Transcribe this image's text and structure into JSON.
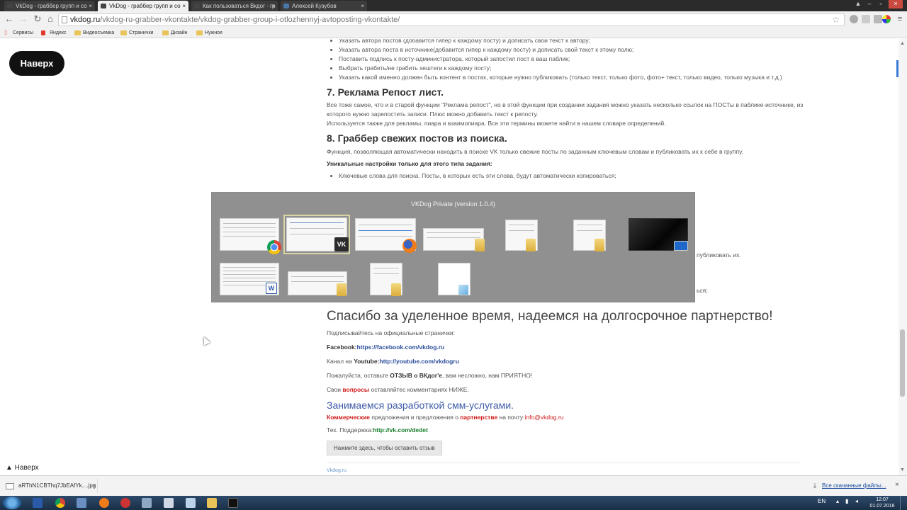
{
  "tabs": [
    {
      "label": "VkDog - граббер групп и со"
    },
    {
      "label": "VkDog - граббер групп и со"
    },
    {
      "label": "Как пользоваться Вкдог - гр"
    },
    {
      "label": "Алексей Кузубов"
    }
  ],
  "address": {
    "host": "vkdog.ru",
    "path": "/vkdog-ru-grabber-vkontakte/vkdog-grabber-group-i-otlozhennyj-avtoposting-vkontakte/"
  },
  "bookmarks": [
    "Сервисы",
    "Яндекс",
    "Видеосъемка",
    "Странички",
    "Дизайн",
    "Нужное"
  ],
  "page": {
    "naverh_top": "Наверх",
    "naverh_bottom": "▲ Наверх",
    "bullets_top": [
      "Указать автора постов (добавится гипер к каждому посту) и дописать свой текст к автору;",
      "Указать автора поста в источнике(добавится гипер к каждому посту) и дописать свой текст к этому полю;",
      "Поставить подпись к посту-администратора, который запостил пост в ваш паблик;",
      "Выбрать грабить/не грабить хештеги к каждому посту;",
      "Указать какой именно должен быть контент в постах, которые нужно публиковать (только текст, только фото, фото+ текст, только видео, только музыка и т.д.)"
    ],
    "h7": "7. Реклама Репост лист.",
    "p7a": "Все тоже самое, что и в старой функции \"Реклама репост\", но в этой функции при создании задания можно указать несколько ссылок на ПОСТы в паблике-источнике, из которого нужно зарепостить записи. Плюс можно добавить текст к репосту.",
    "p7b": "Используется также для рекламы, пиара и взаимопиара. Все эти термины можете найти в нашем словаре определений.",
    "h8": "8. Граббер свежих постов из поиска.",
    "p8": "Функция, позволяющая автоматически находить в поиске VK только свежие посты по заданным ключевым словам и публиковать их к себе в группу.",
    "unique": "Уникальные настройки только для этого типа задания:",
    "bullet8": "Ключевые слова для поиска. Посты, в которых есть эти слова, будут автоматически копироваться;",
    "partial1": "публиковать их.",
    "partial2": "ься;",
    "thanks": "Спасибо за уделенное время, надеемся на долгосрочное партнерство!",
    "subscribe": "Подписывайтесь на официальные странички:",
    "fb_label": "Facebook:",
    "fb_link": "https://facebook.com/vkdog.ru",
    "yt_prefix": "Канал на ",
    "yt_label": "Youtube:",
    "yt_link": "http://youtube.com/vkdogru",
    "review_a": "Пожалуйста, оставьте ",
    "review_b": "ОТЗЫВ о ВКдог'е",
    "review_c": ", вам несложно, нам ПРИЯТНО!",
    "questions_a": "Свои ",
    "questions_b": "вопросы",
    "questions_c": " оставляйтес комментариях НИЖЕ.",
    "smm": "Занимаемся разработкой смм-услугами.",
    "comm_a": "Коммерческие",
    "comm_b": " предложения и предложения о ",
    "comm_c": "партнерстве",
    "comm_d": " на почту:",
    "comm_email": "info@vkdog.ru",
    "support_label": "Тех. Поддержка:",
    "support_link": "http://vk.com/dedet",
    "review_button": "Нажмите здесь, чтобы оставить отзыв",
    "footer_link": "Vkdog.ru"
  },
  "switcher": {
    "title": "VKDog Private (version 1.0.4)",
    "thumbs": [
      {
        "badge": "chrome-icon"
      },
      {
        "badge": "vk-icon",
        "selected": true
      },
      {
        "badge": "firefox-icon"
      },
      {
        "badge": "folder-icon"
      },
      {
        "badge": "folder-icon"
      },
      {
        "badge": "folder-icon"
      },
      {
        "badge": "screen-icon"
      },
      {
        "badge": "word-icon"
      },
      {
        "badge": "folder-icon"
      },
      {
        "badge": "folder-icon"
      },
      {
        "badge": "notepad-icon"
      }
    ]
  },
  "download": {
    "filename": "aRThN1CBThq7JbEAfYk....jpg",
    "show_all": "Все скачанные файлы..."
  },
  "taskbar": {
    "lang": "EN",
    "time": "12:07",
    "date": "01.07.2016"
  },
  "colors": {
    "accent_blue": "#3d5aa8",
    "red": "#d01818",
    "green": "#1c7f2c",
    "link": "#2b4e9a"
  }
}
